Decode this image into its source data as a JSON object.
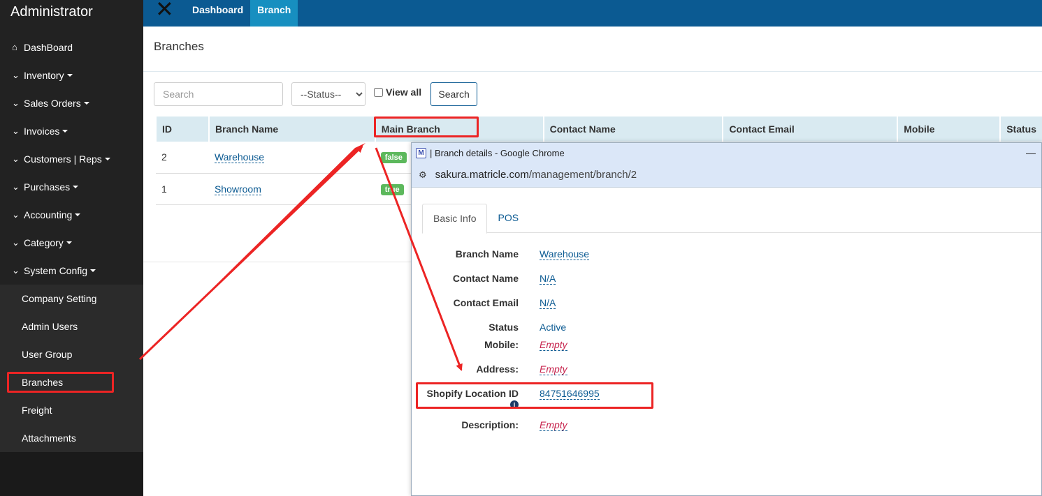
{
  "sidebar": {
    "brand": "Administrator",
    "items": [
      {
        "label": "DashBoard",
        "icon": "home-icon",
        "caret": false
      },
      {
        "label": "Inventory",
        "icon": "chevron-down-icon",
        "caret": true
      },
      {
        "label": "Sales Orders",
        "icon": "chevron-down-icon",
        "caret": true
      },
      {
        "label": "Invoices",
        "icon": "chevron-down-icon",
        "caret": true
      },
      {
        "label": "Customers | Reps",
        "icon": "chevron-down-icon",
        "caret": true
      },
      {
        "label": "Purchases",
        "icon": "chevron-down-icon",
        "caret": true
      },
      {
        "label": "Accounting",
        "icon": "chevron-down-icon",
        "caret": true
      },
      {
        "label": "Category",
        "icon": "chevron-down-icon",
        "caret": true
      },
      {
        "label": "System Config",
        "icon": "chevron-down-icon",
        "caret": true
      }
    ],
    "subitems": [
      {
        "label": "Company Setting"
      },
      {
        "label": "Admin Users"
      },
      {
        "label": "User Group"
      },
      {
        "label": "Branches"
      },
      {
        "label": "Freight"
      },
      {
        "label": "Attachments"
      }
    ]
  },
  "topbar": {
    "tabs": [
      {
        "label": "Dashboard"
      },
      {
        "label": "Branch"
      }
    ]
  },
  "page": {
    "title": "Branches",
    "search_placeholder": "Search",
    "status_select": "--Status--",
    "view_all_label": "View all",
    "search_button": "Search"
  },
  "table": {
    "headers": [
      "ID",
      "Branch Name",
      "Main Branch",
      "Contact Name",
      "Contact Email",
      "Mobile",
      "Status"
    ],
    "rows": [
      {
        "id": "2",
        "name": "Warehouse",
        "main": "false"
      },
      {
        "id": "1",
        "name": "Showroom",
        "main": "true"
      }
    ]
  },
  "popup": {
    "window_title": "| Branch details - Google Chrome",
    "logo_letter": "M",
    "minimize": "—",
    "url_host": "sakura.matricle.com",
    "url_path": "/management/branch/2",
    "tabs": [
      "Basic Info",
      "POS"
    ],
    "fields": [
      {
        "label": "Branch Name",
        "value": "Warehouse"
      },
      {
        "label": "Contact Name",
        "value": "N/A"
      },
      {
        "label": "Contact Email",
        "value": "N/A"
      },
      {
        "label": "Status",
        "value": "Active"
      },
      {
        "label": "Mobile:",
        "value": "Empty"
      },
      {
        "label": "Address:",
        "value": "Empty"
      },
      {
        "label": "Shopify Location ID",
        "value": "84751646995"
      },
      {
        "label": "Description:",
        "value": "Empty"
      }
    ]
  },
  "colors": {
    "sidebar_bg": "#222222",
    "topbar_bg": "#0b5a92",
    "active_tab": "#178fc0",
    "badge_green": "#5cb85c",
    "highlight_red": "#ec2424"
  }
}
